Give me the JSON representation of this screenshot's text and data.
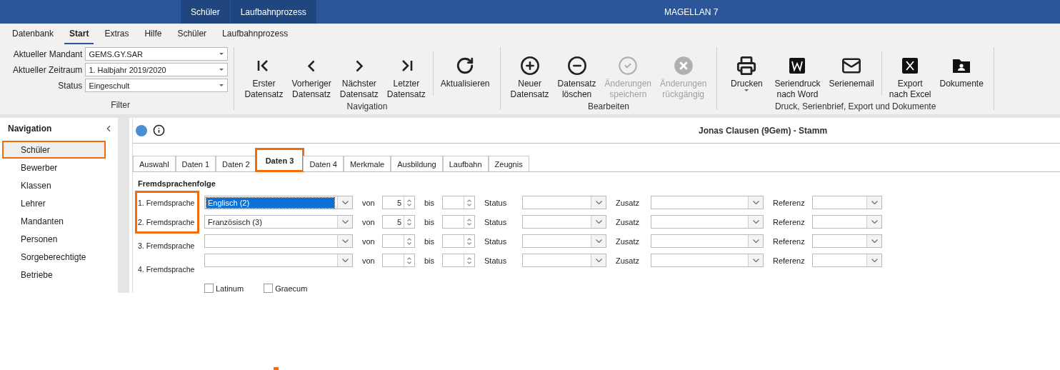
{
  "title_bar": {
    "context_tabs": [
      {
        "label": "Schüler"
      },
      {
        "label": "Laufbahnprozess"
      }
    ],
    "title": "MAGELLAN 7"
  },
  "menu": [
    {
      "label": "Datenbank",
      "selected": false
    },
    {
      "label": "Start",
      "selected": true
    },
    {
      "label": "Extras",
      "selected": false
    },
    {
      "label": "Hilfe",
      "selected": false
    },
    {
      "label": "Schüler",
      "selected": false
    },
    {
      "label": "Laufbahnprozess",
      "selected": false
    }
  ],
  "filter": {
    "label": "Filter",
    "fields": [
      {
        "label": "Aktueller Mandant",
        "value": "GEMS.GY.SAR"
      },
      {
        "label": "Aktueller Zeitraum",
        "value": "1. Halbjahr 2019/2020"
      },
      {
        "label": "Status",
        "value": "Eingeschult"
      }
    ]
  },
  "ribbon_groups": [
    {
      "label": "Navigation",
      "buttons": [
        {
          "kind": "first",
          "lines": [
            "Erster",
            "Datensatz"
          ],
          "disabled": false
        },
        {
          "kind": "previous",
          "lines": [
            "Vorheriger",
            "Datensatz"
          ],
          "disabled": false
        },
        {
          "kind": "next",
          "lines": [
            "Nächster",
            "Datensatz"
          ],
          "disabled": false
        },
        {
          "kind": "last",
          "lines": [
            "Letzter",
            "Datensatz"
          ],
          "disabled": false
        },
        {
          "kind": "refresh",
          "lines": [
            "Aktualisieren"
          ],
          "disabled": false,
          "separator_before": true
        }
      ]
    },
    {
      "label": "Bearbeiten",
      "buttons": [
        {
          "kind": "add",
          "lines": [
            "Neuer",
            "Datensatz"
          ],
          "disabled": false
        },
        {
          "kind": "remove",
          "lines": [
            "Datensatz",
            "löschen"
          ],
          "disabled": false
        },
        {
          "kind": "save",
          "lines": [
            "Änderungen",
            "speichern"
          ],
          "disabled": true
        },
        {
          "kind": "undo",
          "lines": [
            "Änderungen",
            "rückgängig"
          ],
          "disabled": true
        }
      ]
    },
    {
      "label": "Druck, Serienbrief, Export und Dokumente",
      "buttons": [
        {
          "kind": "print",
          "lines": [
            "Drucken"
          ],
          "disabled": false,
          "dropdown": true
        },
        {
          "kind": "word",
          "lines": [
            "Seriendruck",
            "nach Word"
          ],
          "disabled": false
        },
        {
          "kind": "mail",
          "lines": [
            "Serienemail"
          ],
          "disabled": false
        },
        {
          "kind": "excel",
          "lines": [
            "Export",
            "nach Excel"
          ],
          "disabled": false,
          "separator_before": true
        },
        {
          "kind": "documents",
          "lines": [
            "Dokumente"
          ],
          "disabled": false
        }
      ]
    }
  ],
  "sidebar": {
    "title": "Navigation",
    "items": [
      {
        "label": "Schüler",
        "selected": true,
        "highlighted": true
      },
      {
        "label": "Bewerber",
        "selected": false,
        "highlighted": false
      },
      {
        "label": "Klassen",
        "selected": false,
        "highlighted": false
      },
      {
        "label": "Lehrer",
        "selected": false,
        "highlighted": false
      },
      {
        "label": "Mandanten",
        "selected": false,
        "highlighted": false
      },
      {
        "label": "Personen",
        "selected": false,
        "highlighted": false
      },
      {
        "label": "Sorgeberechtigte",
        "selected": false,
        "highlighted": false
      },
      {
        "label": "Betriebe",
        "selected": false,
        "highlighted": false
      }
    ]
  },
  "record": {
    "title": "Jonas Clausen (9Gem) - Stamm"
  },
  "tabs": [
    {
      "label": "Auswahl",
      "selected": false,
      "highlighted": false
    },
    {
      "label": "Daten 1",
      "selected": false,
      "highlighted": false
    },
    {
      "label": "Daten 2",
      "selected": false,
      "highlighted": false
    },
    {
      "label": "Daten 3",
      "selected": true,
      "highlighted": true
    },
    {
      "label": "Daten 4",
      "selected": false,
      "highlighted": false
    },
    {
      "label": "Merkmale",
      "selected": false,
      "highlighted": false
    },
    {
      "label": "Ausbildung",
      "selected": false,
      "highlighted": false
    },
    {
      "label": "Laufbahn",
      "selected": false,
      "highlighted": false
    },
    {
      "label": "Zeugnis",
      "selected": false,
      "highlighted": false
    }
  ],
  "section": {
    "title": "Fremdsprachenfolge",
    "rows": [
      {
        "label": "1. Fremdsprache",
        "highlighted": true,
        "language": "Englisch (2)",
        "focused": true,
        "von_label": "von",
        "von": "5",
        "bis_label": "bis",
        "status_label": "Status",
        "zusatz_label": "Zusatz",
        "referenz_label": "Referenz"
      },
      {
        "label": "2. Fremdsprache",
        "highlighted": true,
        "language": "Französisch (3)",
        "focused": false,
        "von_label": "von",
        "von": "5",
        "bis_label": "bis",
        "status_label": "Status",
        "zusatz_label": "Zusatz",
        "referenz_label": "Referenz"
      },
      {
        "label": "3. Fremdsprache",
        "highlighted": false,
        "von_label": "von",
        "bis_label": "bis",
        "status_label": "Status",
        "zusatz_label": "Zusatz",
        "referenz_label": "Referenz"
      },
      {
        "label": "4. Fremdsprache",
        "highlighted": false,
        "von_label": "von",
        "bis_label": "bis",
        "status_label": "Status",
        "zusatz_label": "Zusatz",
        "referenz_label": "Referenz"
      }
    ],
    "checkboxes": [
      {
        "label": "Latinum",
        "checked": false
      },
      {
        "label": "Graecum",
        "checked": false
      }
    ]
  }
}
